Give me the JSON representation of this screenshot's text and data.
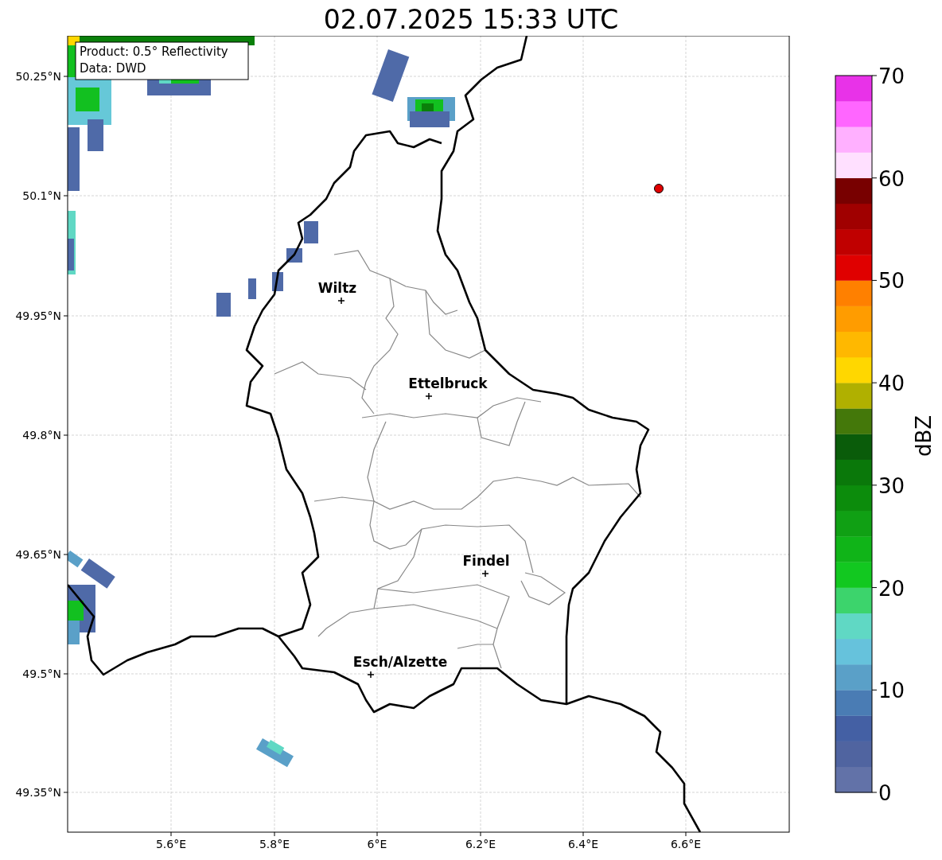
{
  "title": "02.07.2025 15:33 UTC",
  "info_box": [
    "Product: 0.5° Reflectivity",
    "Data: DWD"
  ],
  "lat_labels": [
    "50.25°N",
    "50.1°N",
    "49.95°N",
    "49.8°N",
    "49.65°N",
    "49.5°N",
    "49.35°N"
  ],
  "lon_labels": [
    "5.6°E",
    "5.8°E",
    "6°E",
    "6.2°E",
    "6.4°E",
    "6.6°E"
  ],
  "cities": [
    {
      "name": "Wiltz"
    },
    {
      "name": "Ettelbruck"
    },
    {
      "name": "Findel"
    },
    {
      "name": "Esch/Alzette"
    }
  ],
  "colorbar": {
    "label": "dBZ",
    "ticks": [
      "70",
      "60",
      "50",
      "40",
      "30",
      "20",
      "10",
      "0"
    ],
    "bins": [
      {
        "color": "#6272a8"
      },
      {
        "color": "#5064a0"
      },
      {
        "color": "#4460a4"
      },
      {
        "color": "#4a7cb4"
      },
      {
        "color": "#5aa0c8"
      },
      {
        "color": "#66c2dc"
      },
      {
        "color": "#60d8c4"
      },
      {
        "color": "#3cd46c"
      },
      {
        "color": "#12c820"
      },
      {
        "color": "#10b418"
      },
      {
        "color": "#10a014"
      },
      {
        "color": "#0c8c0c"
      },
      {
        "color": "#0a780a"
      },
      {
        "color": "#0a5c0a"
      },
      {
        "color": "#44780a"
      },
      {
        "color": "#b0b000"
      },
      {
        "color": "#ffd700"
      },
      {
        "color": "#ffb800"
      },
      {
        "color": "#ff9c00"
      },
      {
        "color": "#ff8000"
      },
      {
        "color": "#e00000"
      },
      {
        "color": "#c00000"
      },
      {
        "color": "#a00000"
      },
      {
        "color": "#780000"
      },
      {
        "color": "#ffe0ff"
      },
      {
        "color": "#ffb0ff"
      },
      {
        "color": "#ff66ff"
      },
      {
        "color": "#e832e8"
      }
    ]
  }
}
